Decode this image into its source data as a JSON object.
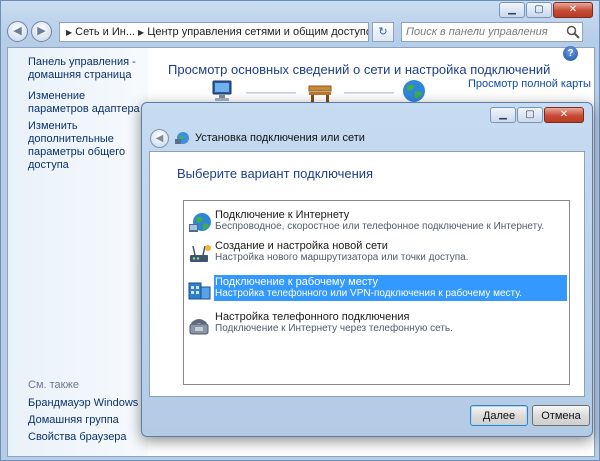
{
  "main_window": {
    "caption_buttons": {
      "minimize": "▁",
      "maximize": "▢",
      "close": "✕"
    },
    "nav": {
      "back": "◀",
      "forward": "▶",
      "breadcrumbs": [
        "Сеть и Ин...",
        "Центр управления сетями и общим доступом"
      ],
      "refresh": "↻",
      "search_placeholder": "Поиск в панели управления"
    },
    "sidebar": {
      "links": [
        "Панель управления - домашняя страница",
        "Изменение параметров адаптера",
        "Изменить дополнительные параметры общего доступа"
      ],
      "see_also_label": "См. также",
      "see_also_links": [
        "Брандмауэр Windows",
        "Домашняя группа",
        "Свойства браузера"
      ]
    },
    "heading": "Просмотр основных сведений о сети и настройка подключений",
    "full_map_link": "Просмотр полной карты",
    "help": "?"
  },
  "dialog": {
    "caption_buttons": {
      "minimize": "▁",
      "maximize": "▢",
      "close": "✕"
    },
    "back": "◀",
    "title": "Установка подключения или сети",
    "heading": "Выберите вариант подключения",
    "options": [
      {
        "title": "Подключение к Интернету",
        "description": "Беспроводное, скоростное или телефонное подключение к Интернету.",
        "icon": "globe-icon"
      },
      {
        "title": "Создание и настройка новой сети",
        "description": "Настройка нового маршрутизатора или точки доступа.",
        "icon": "router-icon"
      },
      {
        "title": "Подключение к рабочему месту",
        "description": "Настройка телефонного или VPN-подключения к рабочему месту.",
        "icon": "workplace-icon",
        "selected": true
      },
      {
        "title": "Настройка телефонного подключения",
        "description": "Подключение к Интернету через телефонную сеть.",
        "icon": "phone-icon"
      }
    ],
    "next_button": "Далее",
    "cancel_button": "Отмена"
  },
  "colors": {
    "selection": "#3399ff",
    "heading_blue": "#1e3e8b",
    "link_blue": "#0b326b"
  }
}
